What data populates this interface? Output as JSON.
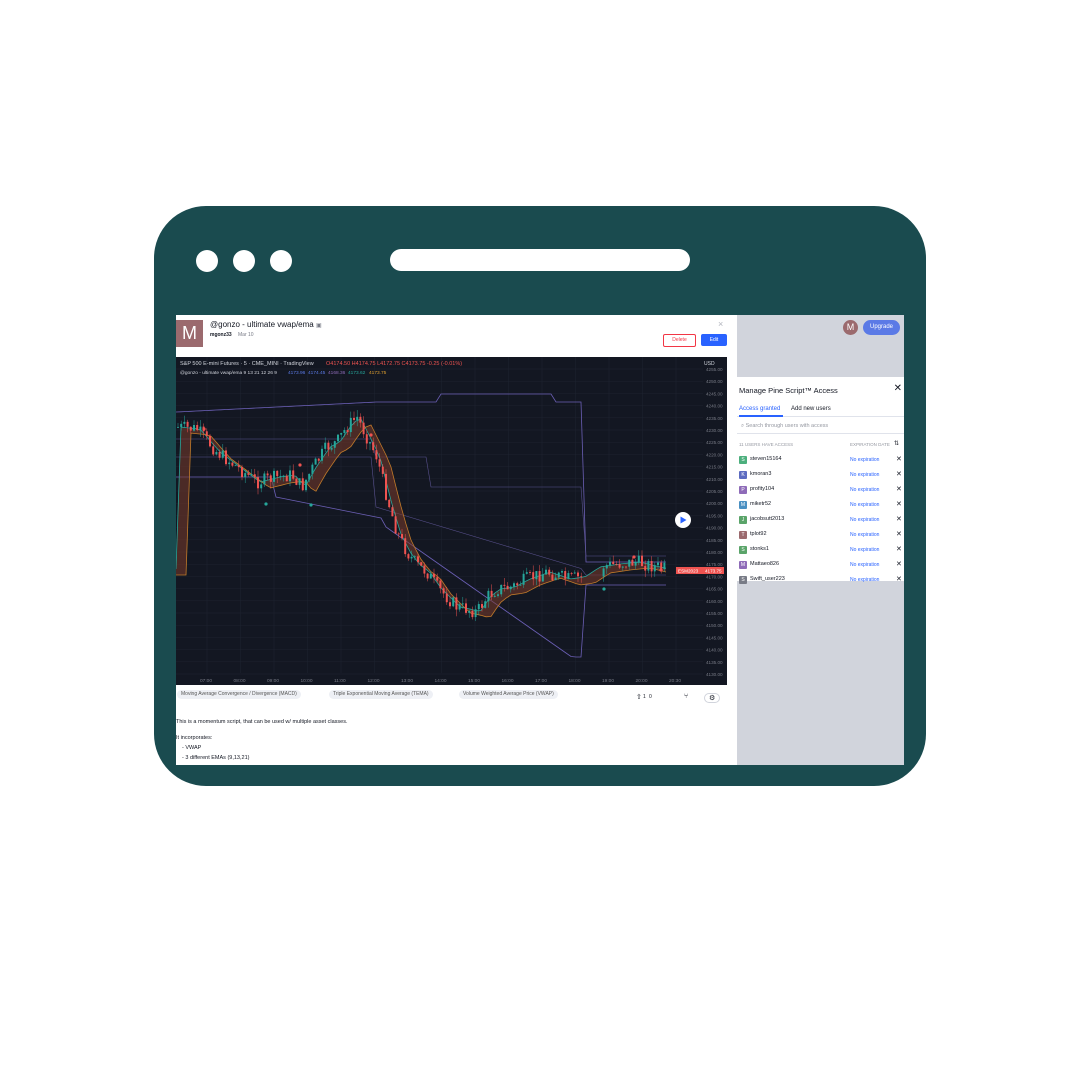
{
  "script": {
    "avatar_letter": "M",
    "title": "@gonzo - ultimate vwap/ema",
    "author": "mgonz33",
    "date": "Mar 10",
    "delete_label": "Delete",
    "edit_label": "Edit",
    "close_glyph": "×",
    "lock_glyph": "🔒"
  },
  "chart_header": {
    "symbol": "S&P 500 E-mini Futures · 5 · CME_MINI · TradingView",
    "ohlc": "O4174.50 H4174.75 L4172.75 C4173.75 -0.25 (-0.01%)",
    "indicator": "@gonzo - ultimate vwap/ema 9 13 21 12 26 9",
    "ind_values": [
      "4173.96",
      "4174.45",
      "4168.36",
      "4173.62",
      "4173.75"
    ],
    "currency": "USD"
  },
  "price_labels": [
    "4255.00",
    "4250.00",
    "4245.00",
    "4240.00",
    "4235.00",
    "4230.00",
    "4225.00",
    "4220.00",
    "4215.00",
    "4210.00",
    "4205.00",
    "4200.00",
    "4195.00",
    "4190.00",
    "4185.00",
    "4180.00",
    "4175.00",
    "4170.00",
    "4165.00",
    "4160.00",
    "4155.00",
    "4150.00",
    "4145.00",
    "4140.00",
    "4135.00",
    "4130.00",
    "4125.00"
  ],
  "current_price": {
    "label": "ESM2023",
    "value": "4173.75"
  },
  "time_labels": [
    "07:00",
    "08:00",
    "09:00",
    "10:00",
    "11:00",
    "12:00",
    "13:00",
    "14:00",
    "15:00",
    "16:00",
    "17:00",
    "18:00",
    "19:00",
    "20:00",
    "20:30"
  ],
  "chips": [
    "Moving Average Convergence / Divergence (MACD)",
    "Triple Exponential Moving Average (TEMA)",
    "Volume Weighted Average Price (VWAP)"
  ],
  "stats": {
    "likes": "1",
    "comments": "0"
  },
  "description": [
    "This is a momentum script, that can be used w/ multiple asset classes.",
    "",
    "It incorporates:",
    "  - VWAP",
    "  - 3 different EMAs (9,13,21)"
  ],
  "header": {
    "user_initial": "M",
    "upgrade_label": "Upgrade"
  },
  "access_panel": {
    "title": "Manage Pine Script™ Access",
    "tabs": [
      "Access granted",
      "Add new users"
    ],
    "search_placeholder": "Search through users with access",
    "col_users": "11 USERS HAVE ACCESS",
    "col_expiration": "EXPIRATION DATE",
    "users": [
      {
        "initial": "S",
        "name": "steven15164",
        "color": "#4caf7d",
        "expiration": "No expiration"
      },
      {
        "initial": "K",
        "name": "kmoran3",
        "color": "#5c6bc0",
        "expiration": "No expiration"
      },
      {
        "initial": "P",
        "name": "profity104",
        "color": "#8e6bb8",
        "expiration": "No expiration"
      },
      {
        "initial": "M",
        "name": "miketr52",
        "color": "#4a90c2",
        "expiration": "No expiration"
      },
      {
        "initial": "J",
        "name": "jacobsutt2013",
        "color": "#5aa469",
        "expiration": "No expiration"
      },
      {
        "initial": "T",
        "name": "tplot92",
        "color": "#9b6a6e",
        "expiration": "No expiration"
      },
      {
        "initial": "S",
        "name": "stonks1",
        "color": "#5aa469",
        "expiration": "No expiration"
      },
      {
        "initial": "M",
        "name": "Mattaeo826",
        "color": "#8e6bb8",
        "expiration": "No expiration"
      },
      {
        "initial": "S",
        "name": "Swift_user223",
        "color": "#787b86",
        "expiration": "No expiration"
      }
    ]
  },
  "colors": {
    "frame": "#1a4b4f",
    "accent": "#2962ff",
    "danger": "#f23645",
    "bull": "#26a69a",
    "bear": "#ef5350"
  }
}
